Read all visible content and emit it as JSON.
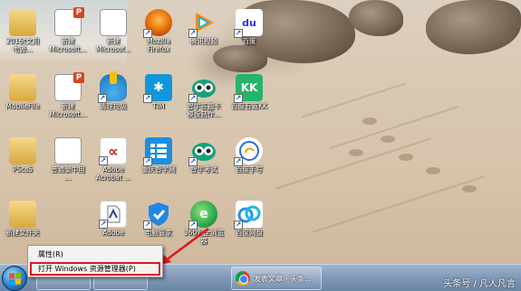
{
  "desktop": {
    "icons": [
      {
        "label": "2016t文用\n电源...",
        "kind": "folder"
      },
      {
        "label": "新建\nMicrosoft...",
        "kind": "ppt"
      },
      {
        "label": "新建\nMicrosof...",
        "kind": "doc"
      },
      {
        "label": "Mozilla\nFirefox",
        "kind": "app",
        "color": "#e66000"
      },
      {
        "label": "腾讯视频",
        "kind": "app",
        "color": "#2aa5e6"
      },
      {
        "label": "百度",
        "kind": "app",
        "color": "#2932e1"
      },
      {
        "label": "MobileFile",
        "kind": "folder"
      },
      {
        "label": "新建\nMicrosoft...",
        "kind": "ppt"
      },
      {
        "label": "清理垃圾",
        "kind": "app",
        "color": "#2f8ccf"
      },
      {
        "label": "TIM",
        "kind": "app",
        "color": "#1296db"
      },
      {
        "label": "智学答题卡\n模板制作...",
        "kind": "app",
        "color": "#12a37a"
      },
      {
        "label": "百度有道KK",
        "kind": "app",
        "color": "#26b36b"
      },
      {
        "label": "PScs5",
        "kind": "folder"
      },
      {
        "label": "普通录中用\n...",
        "kind": "doc"
      },
      {
        "label": "Adobe\nAcrobat ...",
        "kind": "pdf"
      },
      {
        "label": "重庆智学网",
        "kind": "app",
        "color": "#1b8ee0"
      },
      {
        "label": "智学考试",
        "kind": "app",
        "color": "#12a37a"
      },
      {
        "label": "百度手写",
        "kind": "app",
        "color": "#2a6fd6"
      },
      {
        "label": "新建文件夹",
        "kind": "folder"
      },
      {
        "label": "Adobe",
        "kind": "pdf"
      },
      {
        "label": "电脑管家",
        "kind": "app",
        "color": "#1e88e5"
      },
      {
        "label": "360安全浏览\n器",
        "kind": "app",
        "color": "#2da84a"
      },
      {
        "label": "百度网盘",
        "kind": "app",
        "color": "#2b8fe4"
      }
    ]
  },
  "jumplist": {
    "items": [
      {
        "label": "属性(R)"
      },
      {
        "label": "打开 Windows 资源管理器(P)"
      }
    ]
  },
  "taskbar": {
    "chrome_label": "发表文章 - 头条...",
    "accent": "#7e98b6"
  },
  "watermark": "头条号 / 凡人凡言",
  "colors": {
    "highlight": "#e0161d"
  }
}
